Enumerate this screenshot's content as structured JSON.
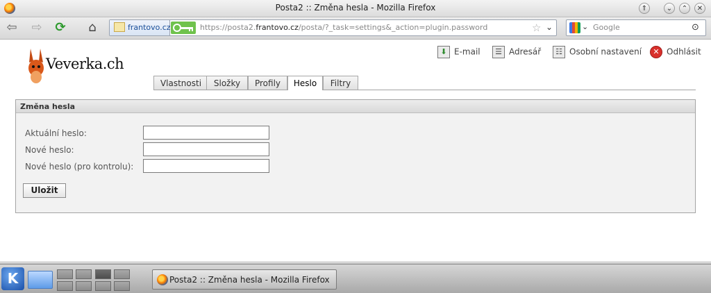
{
  "window": {
    "title": "Posta2 :: Změna hesla - Mozilla Firefox"
  },
  "browser": {
    "site_label": "frantovo.cz",
    "url_plain_start": "https://posta2.",
    "url_domain": "frantovo.cz",
    "url_rest": "/posta/?_task=settings&_action=plugin.password",
    "search_placeholder": "Google"
  },
  "app": {
    "logo_text": "Veverka.ch",
    "top_links": [
      {
        "label": "E-mail",
        "icon": "email-icon"
      },
      {
        "label": "Adresář",
        "icon": "addressbook-icon"
      },
      {
        "label": "Osobní nastavení",
        "icon": "settings-icon"
      },
      {
        "label": "Odhlásit",
        "icon": "logout-icon"
      }
    ],
    "tabs": [
      {
        "label": "Vlastnosti"
      },
      {
        "label": "Složky"
      },
      {
        "label": "Profily"
      },
      {
        "label": "Heslo",
        "active": true
      },
      {
        "label": "Filtry"
      }
    ]
  },
  "form": {
    "title": "Změna hesla",
    "fields": [
      {
        "label": "Aktuální heslo:",
        "value": ""
      },
      {
        "label": "Nové heslo:",
        "value": ""
      },
      {
        "label": "Nové heslo (pro kontrolu):",
        "value": ""
      }
    ],
    "save_label": "Uložit"
  },
  "taskbar": {
    "task_label": "Posta2 :: Změna hesla - Mozilla Firefox"
  },
  "colors": {
    "logout_icon": "#d9302c",
    "key_green": "#6fc24c",
    "kde_blue": "#1a4fa8"
  }
}
